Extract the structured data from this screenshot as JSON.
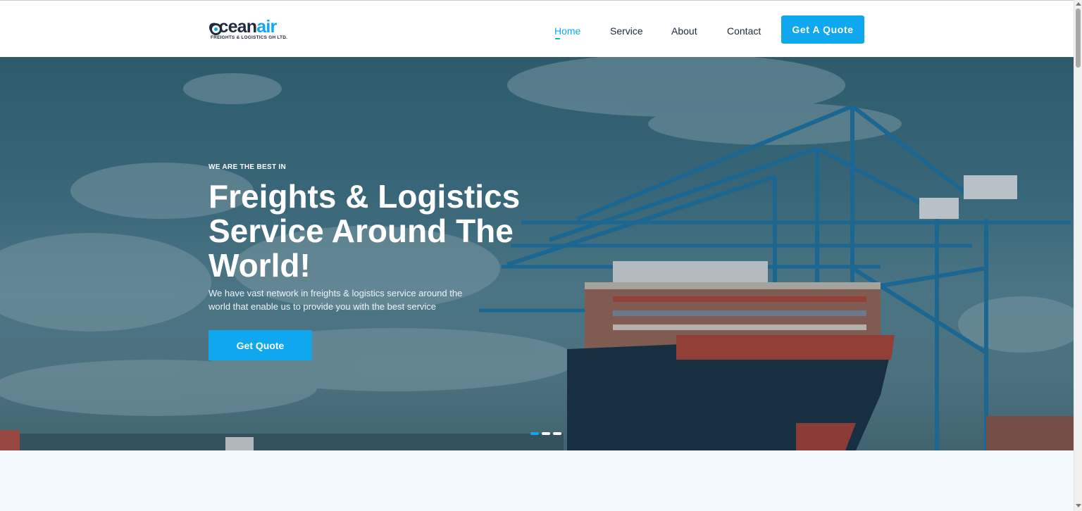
{
  "brand": {
    "name_main": "ocean",
    "name_accent": "air",
    "tagline": "FREIGHTS & LOGISTICS GH LTD.",
    "color_primary": "#0fa8ee",
    "color_dark": "#1f2a3c"
  },
  "nav": {
    "items": [
      {
        "label": "Home",
        "active": true
      },
      {
        "label": "Service",
        "active": false
      },
      {
        "label": "About",
        "active": false
      },
      {
        "label": "Contact",
        "active": false
      }
    ],
    "cta_label": "Get A Quote"
  },
  "hero": {
    "eyebrow": "WE ARE THE BEST IN",
    "headline_line1": "Freights & Logistics",
    "headline_line2": "Service Around The",
    "headline_line3": "World!",
    "description_line1": "We have vast network in freights & logistics service around the",
    "description_line2": "world that enable us to provide you with the best service",
    "button_label": "Get Quote",
    "background_icon": "cargo-ship-port-photo",
    "carousel_slide_count": 3,
    "carousel_active_index": 0
  }
}
